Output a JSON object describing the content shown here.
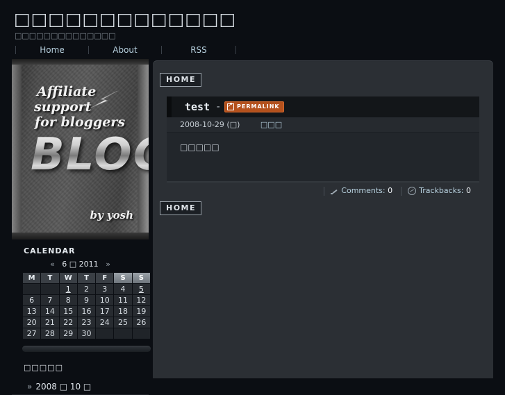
{
  "header": {
    "site_title": "□□□□□□□□□□□□□",
    "site_description": "□□□□□□□□□□□□□□",
    "nav": [
      {
        "label": "Home"
      },
      {
        "label": "About"
      },
      {
        "label": "RSS"
      }
    ]
  },
  "content": {
    "home_button_top": "HOME",
    "home_button_bottom": "HOME",
    "entry": {
      "title": "test",
      "dash": "-",
      "permalink_label": "PERMALINK",
      "permalink_icon": "external-link-arrow-icon",
      "date": "2008-10-29 (□)",
      "category": "□□□",
      "body": "□□□□□",
      "comments_label": "Comments:",
      "comments_count": "0",
      "trackbacks_label": "Trackbacks:",
      "trackbacks_count": "0",
      "comments_icon": "pencil-icon",
      "trackbacks_icon": "circle-arrow-icon"
    }
  },
  "sidebar": {
    "banner": {
      "line1": "Affiliate",
      "line2": "support",
      "line3": "for bloggers",
      "wordmark": "BLOG",
      "byline": "by yosh",
      "bolt_icon": "lightning-bolt-icon"
    },
    "calendar": {
      "heading": "CALENDAR",
      "prev_label": "«",
      "next_label": "»",
      "month_year": "6 □ 2011",
      "weekdays": [
        "M",
        "T",
        "W",
        "T",
        "F",
        "S",
        "S"
      ],
      "weekend_indices": [
        5,
        6
      ],
      "leading_blanks": 2,
      "weeks": [
        [
          "",
          "",
          "1",
          "2",
          "3",
          "4",
          "5"
        ],
        [
          "6",
          "7",
          "8",
          "9",
          "10",
          "11",
          "12"
        ],
        [
          "13",
          "14",
          "15",
          "16",
          "17",
          "18",
          "19"
        ],
        [
          "20",
          "21",
          "22",
          "23",
          "24",
          "25",
          "26"
        ],
        [
          "27",
          "28",
          "29",
          "30",
          "",
          "",
          ""
        ]
      ],
      "linked_days": [
        "1",
        "5"
      ]
    },
    "archives": {
      "heading": "□□□□□",
      "items": [
        {
          "chevron": "»",
          "label": "2008 □ 10 □"
        }
      ]
    }
  },
  "colors": {
    "page_bg": "#0b0e13",
    "panel_bg": "#2b2f34",
    "accent_permalink": "#b4511d",
    "link_blue": "#b6cfdd"
  }
}
